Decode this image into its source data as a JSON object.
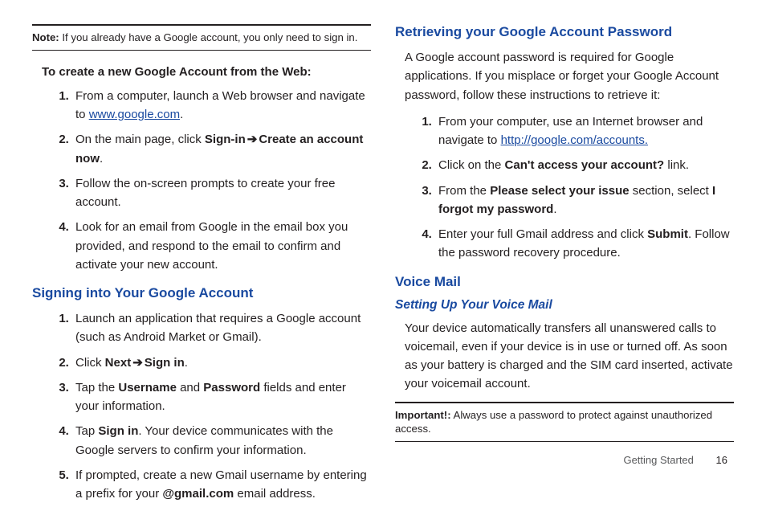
{
  "leftColumn": {
    "note": {
      "label": "Note:",
      "text": " If you already have a Google account, you only need to sign in."
    },
    "createHeading": "To create a new Google Account from the Web:",
    "createSteps": {
      "s1a": "From a computer, launch a Web browser and navigate to ",
      "s1link": "www.google.com",
      "s1b": ".",
      "s2a": "On the main page, click ",
      "s2b1": "Sign-in",
      "s2arrow": " ➔ ",
      "s2b2": "Create an account now",
      "s2c": ".",
      "s3": "Follow the on-screen prompts to create your free account.",
      "s4": "Look for an email from Google in the email box you provided, and respond to the email to confirm and activate your new account."
    },
    "signinHeading": "Signing into Your Google Account",
    "signinSteps": {
      "s1": "Launch an application that requires a Google account (such as Android Market or Gmail).",
      "s2a": "Click ",
      "s2b1": "Next",
      "s2arrow": " ➔ ",
      "s2b2": "Sign in",
      "s2c": ".",
      "s3a": "Tap the ",
      "s3b1": "Username",
      "s3mid": " and ",
      "s3b2": "Password",
      "s3c": " fields and enter your information.",
      "s4a": "Tap ",
      "s4b": "Sign in",
      "s4c": ". Your device communicates with the Google servers to confirm your information.",
      "s5a": "If prompted, create a new Gmail username by entering a prefix for your ",
      "s5b": "@gmail.com",
      "s5c": " email address."
    }
  },
  "rightColumn": {
    "retrieveHeading": "Retrieving your Google Account Password",
    "retrievePara": "A Google account password is required for Google applications. If you misplace or forget your Google Account password, follow these instructions to retrieve it:",
    "retrieveSteps": {
      "s1a": "From your computer, use an Internet browser and navigate to ",
      "s1link": "http://google.com/accounts.",
      "s2a": "Click on the ",
      "s2b": "Can't access your account?",
      "s2c": " link.",
      "s3a": "From the ",
      "s3b1": "Please select your issue",
      "s3mid": " section, select ",
      "s3b2": "I forgot my password",
      "s3c": ".",
      "s4a": "Enter your full Gmail address and click ",
      "s4b": "Submit",
      "s4c": ". Follow the password recovery procedure."
    },
    "voicemailHeading": "Voice Mail",
    "voicemailSub": "Setting Up Your Voice Mail",
    "voicemailPara": "Your device automatically transfers all unanswered calls to voicemail, even if your device is in use or turned off. As soon as your battery is charged and the SIM card inserted, activate your voicemail account.",
    "important": {
      "label": "Important!:",
      "text": " Always use a password to protect against unauthorized access."
    }
  },
  "footer": {
    "section": "Getting Started",
    "page": "16"
  }
}
